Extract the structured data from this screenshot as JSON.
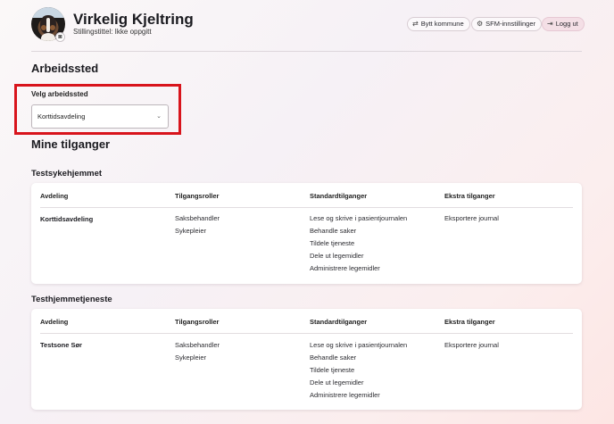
{
  "header": {
    "name": "Virkelig Kjeltring",
    "role_line": "Stillingstittel: Ikke oppgitt",
    "avatar_alt": "profile photo of dog",
    "buttons": {
      "switch_municipality": "Bytt kommune",
      "sfm_settings": "SFM-innstillinger",
      "logout": "Logg ut"
    }
  },
  "workplace": {
    "title": "Arbeidssted",
    "select_label": "Velg arbeidssted",
    "selected_value": "Korttidsavdeling"
  },
  "access": {
    "title": "Mine tilganger",
    "columns": [
      "Avdeling",
      "Tilgangsroller",
      "Standardtilganger",
      "Ekstra tilganger"
    ],
    "groups": [
      {
        "name": "Testsykehjemmet",
        "rows": [
          {
            "department": "Korttidsavdeling",
            "roles": [
              "Saksbehandler",
              "Sykepleier"
            ],
            "standard": [
              "Lese og skrive i pasientjournalen",
              "Behandle saker",
              "Tildele tjeneste",
              "Dele ut legemidler",
              "Administrere legemidler"
            ],
            "extra": [
              "Eksportere journal"
            ]
          }
        ]
      },
      {
        "name": "Testhjemmetjeneste",
        "rows": [
          {
            "department": "Testsone Sør",
            "roles": [
              "Saksbehandler",
              "Sykepleier"
            ],
            "standard": [
              "Lese og skrive i pasientjournalen",
              "Behandle saker",
              "Tildele tjeneste",
              "Dele ut legemidler",
              "Administrere legemidler"
            ],
            "extra": [
              "Eksportere journal"
            ]
          }
        ]
      }
    ]
  },
  "colors": {
    "highlight": "#d8141c",
    "logout_bg": "#f4dfe6"
  },
  "icons": {
    "switch": "swap-arrows-icon",
    "settings": "gear-icon",
    "logout": "logout-icon",
    "camera": "camera-icon",
    "select": "chevron-down-icon"
  }
}
